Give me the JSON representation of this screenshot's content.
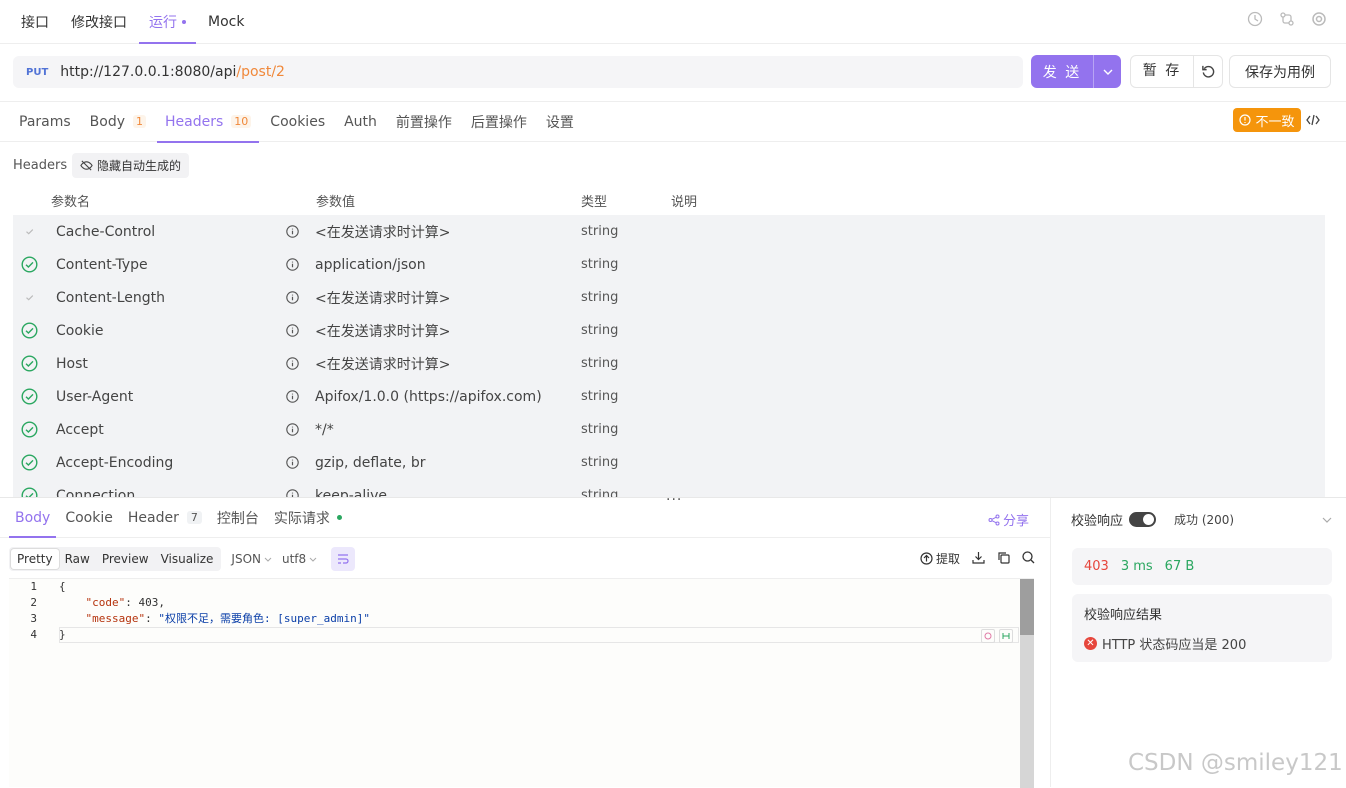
{
  "topnav": {
    "tabs": [
      {
        "label": "接口"
      },
      {
        "label": "修改接口"
      },
      {
        "label": "运行"
      },
      {
        "label": "Mock"
      }
    ]
  },
  "request": {
    "method": "PUT",
    "url_base": "http://127.0.0.1:8080/api",
    "url_path": "/post/2",
    "send_label": "发 送",
    "save_label": "暂 存",
    "save_case_label": "保存为用例"
  },
  "subtabs": [
    {
      "label": "Params",
      "badge": ""
    },
    {
      "label": "Body",
      "badge": "1"
    },
    {
      "label": "Headers",
      "badge": "10"
    },
    {
      "label": "Cookies",
      "badge": ""
    },
    {
      "label": "Auth",
      "badge": ""
    },
    {
      "label": "前置操作",
      "badge": ""
    },
    {
      "label": "后置操作",
      "badge": ""
    },
    {
      "label": "设置",
      "badge": ""
    }
  ],
  "warning_label": "不一致",
  "headers_section": {
    "label": "Headers",
    "hide_label": "隐藏自动生成的",
    "columns": {
      "name": "参数名",
      "value": "参数值",
      "type": "类型",
      "desc": "说明"
    },
    "rows": [
      {
        "name": "Cache-Control",
        "value": "<在发送请求时计算>",
        "type": "string",
        "checked": false
      },
      {
        "name": "Content-Type",
        "value": "application/json",
        "type": "string",
        "checked": true
      },
      {
        "name": "Content-Length",
        "value": "<在发送请求时计算>",
        "type": "string",
        "checked": false
      },
      {
        "name": "Cookie",
        "value": "<在发送请求时计算>",
        "type": "string",
        "checked": true
      },
      {
        "name": "Host",
        "value": "<在发送请求时计算>",
        "type": "string",
        "checked": true
      },
      {
        "name": "User-Agent",
        "value": "Apifox/1.0.0 (https://apifox.com)",
        "type": "string",
        "checked": true
      },
      {
        "name": "Accept",
        "value": "*/*",
        "type": "string",
        "checked": true
      },
      {
        "name": "Accept-Encoding",
        "value": "gzip, deflate, br",
        "type": "string",
        "checked": true
      },
      {
        "name": "Connection",
        "value": "keep-alive",
        "type": "string",
        "checked": true
      }
    ],
    "more": "..."
  },
  "response": {
    "tabs": [
      {
        "label": "Body",
        "badge": ""
      },
      {
        "label": "Cookie",
        "badge": ""
      },
      {
        "label": "Header",
        "badge": "7"
      },
      {
        "label": "控制台",
        "badge": ""
      },
      {
        "label": "实际请求",
        "badge": ""
      }
    ],
    "share_label": "分享",
    "views": [
      "Pretty",
      "Raw",
      "Preview",
      "Visualize"
    ],
    "format": "JSON",
    "encoding": "utf8",
    "extract_label": "提取",
    "line_numbers": [
      "1",
      "2",
      "3",
      "4"
    ],
    "code": {
      "open": "{",
      "code_key": "\"code\"",
      "code_val": "403",
      "message_key": "\"message\"",
      "message_val": "\"权限不足，需要角色: [super_admin]\"",
      "close": "}"
    }
  },
  "validation": {
    "label": "校验响应",
    "status_label": "成功 (200)",
    "status_code": "403",
    "time": "3 ms",
    "size": "67 B",
    "result_title": "校验响应结果",
    "result_error": "HTTP 状态码应当是 200"
  },
  "watermark": "CSDN @smiley121",
  "colors": {
    "accent": "#9373ee",
    "warning": "#f5950c",
    "error": "#e6463c",
    "success": "#2aa760"
  }
}
